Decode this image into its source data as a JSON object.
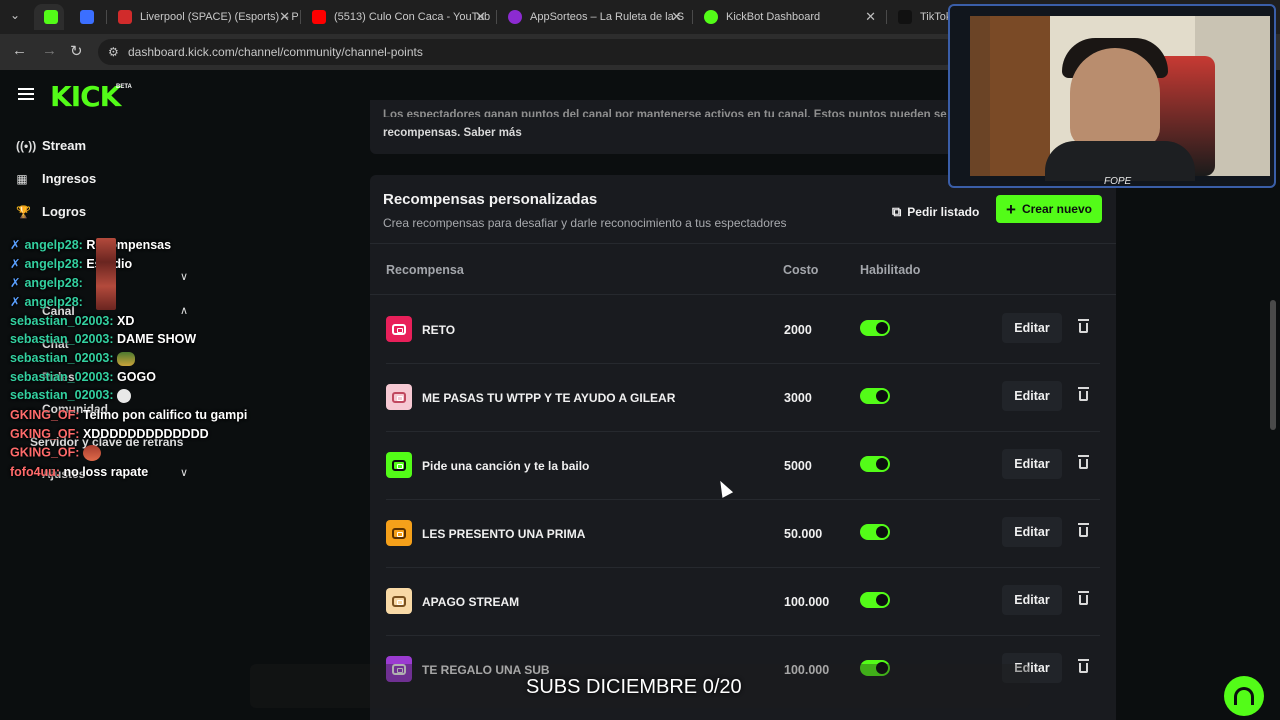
{
  "browser": {
    "tabs": [
      {
        "label": "",
        "icon": "kick-favicon",
        "color": "#53fc18"
      },
      {
        "label": "",
        "icon": "app-favicon",
        "color": "#3b6fff"
      },
      {
        "label": "Liverpool (SPACE) (Esports) – Pe",
        "icon": "liverpool-favicon",
        "color": "#d12b2b"
      },
      {
        "label": "(5513) Culo Con Caca - YouTub",
        "icon": "youtube-favicon",
        "color": "#ff0000"
      },
      {
        "label": "AppSorteos – La Ruleta de la S",
        "icon": "appsorteos-favicon",
        "color": "#8c2bd1"
      },
      {
        "label": "KickBot Dashboard",
        "icon": "kickbot-favicon",
        "color": "#53fc18"
      },
      {
        "label": "TikTok -",
        "icon": "tiktok-favicon",
        "color": "#111111"
      }
    ],
    "url": "dashboard.kick.com/channel/community/channel-points"
  },
  "sidebar": {
    "logo": "KICK",
    "logo_badge": "BETA",
    "items": [
      {
        "label": "Stream",
        "icon": "broadcast-icon"
      },
      {
        "label": "Ingresos",
        "icon": "chart-icon"
      },
      {
        "label": "Logros",
        "icon": "trophy-icon"
      }
    ]
  },
  "chat": [
    {
      "user": "angelp28:",
      "text": "Recompensas",
      "tool": true
    },
    {
      "user": "angelp28:",
      "text": "Estudio",
      "tool": true
    },
    {
      "user": "angelp28:",
      "text": "",
      "tool": true
    },
    {
      "user": "angelp28:",
      "text": "",
      "tool": true
    },
    {
      "user": "sebastian_02003:",
      "text": "XD",
      "tool": false
    },
    {
      "user": "sebastian_02003:",
      "text": "DAME SHOW",
      "tool": false
    },
    {
      "user": "sebastian_02003:",
      "text": "",
      "tool": false
    },
    {
      "user": "sebastian_02003:",
      "text": "GOGO",
      "tool": false
    },
    {
      "user": "sebastian_02003:",
      "text": "",
      "tool": false
    },
    {
      "user": "GKING_OF:",
      "text": "Telmo pon califico tu gampi",
      "tool": false
    },
    {
      "user": "GKING_OF:",
      "text": "XDDDDDDDDDDDDD",
      "tool": false
    },
    {
      "user": "GKING_OF:",
      "text": "",
      "tool": false
    },
    {
      "user": "fofo4uu:",
      "text": "no loss rapate",
      "tool": false
    }
  ],
  "sidebar_hidden": {
    "canal": "Canal",
    "chat": "Chat",
    "roles": "Roles",
    "comunidad": "Comunidad",
    "servidor": "Servidor y clave de retrans",
    "ajustes": "Ajustes"
  },
  "top_card": {
    "text_cut": "Los espectadores ganan puntos del canal por mantenerse activos en tu canal. Estos puntos pueden se",
    "text": "recompensas. Saber más"
  },
  "rewards": {
    "title": "Recompensas personalizadas",
    "subtitle": "Crea recompensas para desafiar y darle reconocimiento a tus espectadores",
    "list_button": "Pedir listado",
    "new_button": "Crear nuevo",
    "columns": {
      "reward": "Recompensa",
      "cost": "Costo",
      "enabled": "Habilitado"
    },
    "edit_label": "Editar",
    "rows": [
      {
        "name": "RETO",
        "cost": "2000",
        "enabled": true,
        "color": "#e8205a"
      },
      {
        "name": "ME PASAS TU WTPP Y TE AYUDO A GILEAR",
        "cost": "3000",
        "enabled": true,
        "color": "#f6c9d3"
      },
      {
        "name": "Pide una canción y te la bailo",
        "cost": "5000",
        "enabled": true,
        "color": "#53fc18"
      },
      {
        "name": "LES PRESENTO UNA PRIMA",
        "cost": "50.000",
        "enabled": true,
        "color": "#f5a01a"
      },
      {
        "name": "APAGO STREAM",
        "cost": "100.000",
        "enabled": true,
        "color": "#f8d9a6"
      },
      {
        "name": "TE REGALO UNA SUB",
        "cost": "100.000",
        "enabled": true,
        "color": "#9b3bd1"
      }
    ]
  },
  "overlay": {
    "cam_label": "FOPE",
    "subs_goal": "SUBS DICIEMBRE 0/20"
  }
}
